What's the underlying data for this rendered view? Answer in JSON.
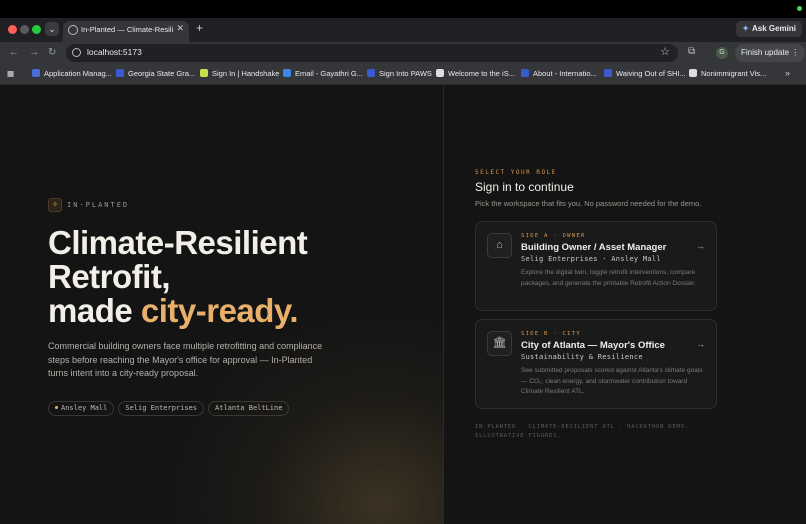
{
  "browser": {
    "tab_title": "In-Planted — Climate-Resilie",
    "tab_close": "✕",
    "new_tab": "+",
    "ask_gemini": "Ask Gemini",
    "url": "localhost:5173",
    "profile_initial": "G",
    "finish_update": "Finish update",
    "bookmarks": [
      {
        "label": "Application Manag...",
        "color": "#4a6fd8"
      },
      {
        "label": "Georgia State Gra...",
        "color": "#3a5bd0"
      },
      {
        "label": "Sign In | Handshake",
        "color": "#c8e04a"
      },
      {
        "label": "Email - Gayathri G...",
        "color": "#3a8be0"
      },
      {
        "label": "Sign Into PAWS",
        "color": "#3a5bd0"
      },
      {
        "label": "Welcome to the iS...",
        "color": "#dddddd"
      },
      {
        "label": "About - Internatio...",
        "color": "#3a5bd0"
      },
      {
        "label": "Waiving Out of SHI...",
        "color": "#3a5bd0"
      },
      {
        "label": "Nonimmigrant Vis...",
        "color": "#dddddd"
      }
    ],
    "bookmarks_more": "»"
  },
  "hero": {
    "brand": "IN-PLANTED",
    "line1": "Climate-Resilient",
    "line2": "Retrofit,",
    "line3_plain": "made ",
    "line3_accent": "city-ready.",
    "subtitle": "Commercial building owners face multiple retrofitting and compliance steps before reaching the Mayor's office for approval — In-Planted turns intent into a city-ready proposal.",
    "pills": [
      "Ansley Mall",
      "Selig Enterprises",
      "Atlanta BeltLine"
    ],
    "accent_color": "#e8b06a"
  },
  "signin": {
    "role_label": "SELECT YOUR ROLE",
    "title": "Sign in to continue",
    "subtitle": "Pick the workspace that fits you. No password needed for the demo.",
    "cards": [
      {
        "side": "SIDE A · OWNER",
        "title": "Building Owner / Asset Manager",
        "subtitle": "Selig Enterprises · Ansley Mall",
        "description": "Explore the digital twin, toggle retrofit interventions, compare packages, and generate the printable Retrofit Action Dossier.",
        "icon": "building-icon"
      },
      {
        "side": "SIDE B · CITY",
        "title": "City of Atlanta — Mayor's Office",
        "subtitle": "Sustainability & Resilience",
        "description": "See submitted proposals scored against Atlanta's climate goals — CO₂, clean energy, and stormwater contribution toward Climate Resilient ATL.",
        "icon": "city-hall-icon"
      }
    ],
    "footer": "IN-PLANTED · CLIMATE-RESILIENT ATL · HACKATHON DEMO. ILLUSTRATIVE FIGURES."
  }
}
